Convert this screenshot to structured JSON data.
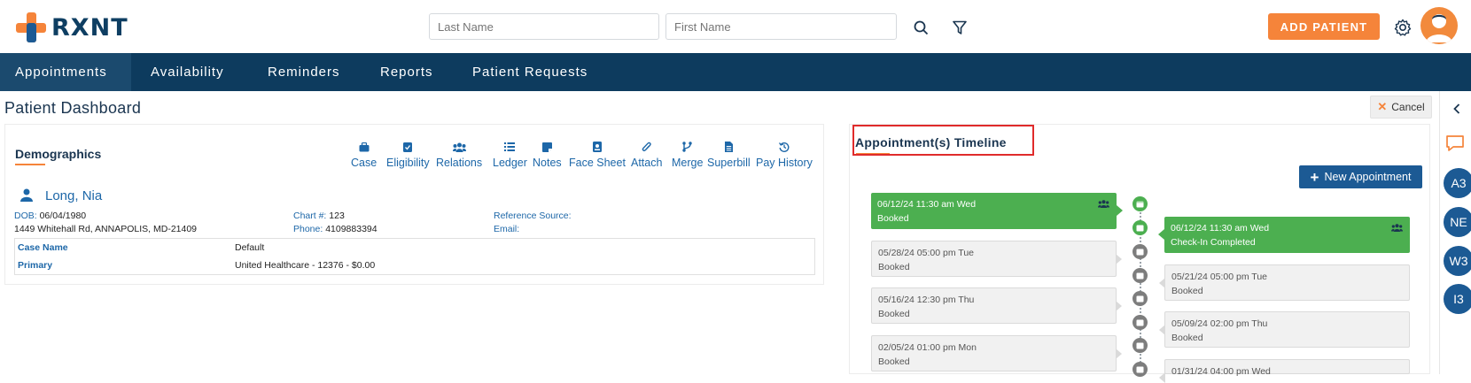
{
  "brand": {
    "name": "RXNT",
    "plus_color": "#f5843a",
    "plus_color2": "#1c5a94"
  },
  "search": {
    "last_name_placeholder": "Last Name",
    "first_name_placeholder": "First Name"
  },
  "header": {
    "add_patient_label": "ADD PATIENT"
  },
  "nav": {
    "items": [
      {
        "label": "Appointments"
      },
      {
        "label": "Availability"
      },
      {
        "label": "Reminders"
      },
      {
        "label": "Reports"
      },
      {
        "label": "Patient Requests"
      }
    ]
  },
  "page": {
    "title": "Patient Dashboard",
    "cancel_label": "Cancel"
  },
  "demographics": {
    "title": "Demographics",
    "tools": [
      {
        "label": "Case",
        "icon": "briefcase-icon"
      },
      {
        "label": "Eligibility",
        "icon": "clipboard-check-icon"
      },
      {
        "label": "Relations",
        "icon": "users-icon"
      },
      {
        "label": "Ledger",
        "icon": "list-icon"
      },
      {
        "label": "Notes",
        "icon": "note-icon"
      },
      {
        "label": "Face Sheet",
        "icon": "id-card-icon"
      },
      {
        "label": "Attach",
        "icon": "paperclip-icon"
      },
      {
        "label": "Merge",
        "icon": "merge-icon"
      },
      {
        "label": "Superbill",
        "icon": "document-icon"
      },
      {
        "label": "Pay History",
        "icon": "history-icon"
      }
    ],
    "patient_name": "Long, Nia",
    "dob_label": "DOB:",
    "dob": "06/04/1980",
    "address": "1449 Whitehall Rd, ANNAPOLIS, MD-21409",
    "chart_label": "Chart #:",
    "chart": "123",
    "phone_label": "Phone:",
    "phone": "4109883394",
    "ref_label": "Reference Source:",
    "email_label": "Email:",
    "case_rows": [
      {
        "key": "Case Name",
        "value": "Default"
      },
      {
        "key": "Primary",
        "value": "United Healthcare - 12376 - $0.00"
      }
    ]
  },
  "timeline": {
    "title": "Appointment(s) Timeline",
    "new_button": "New Appointment",
    "left": [
      {
        "date": "06/12/24 11:30 am Wed",
        "status": "Booked",
        "style": "green"
      },
      {
        "date": "05/28/24 05:00 pm Tue",
        "status": "Booked",
        "style": "gray"
      },
      {
        "date": "05/16/24 12:30 pm Thu",
        "status": "Booked",
        "style": "gray"
      },
      {
        "date": "02/05/24 01:00 pm Mon",
        "status": "Booked",
        "style": "gray"
      }
    ],
    "right": [
      {
        "date": "06/12/24 11:30 am Wed",
        "status": "Check-In Completed",
        "style": "green"
      },
      {
        "date": "05/21/24 05:00 pm Tue",
        "status": "Booked",
        "style": "gray"
      },
      {
        "date": "05/09/24 02:00 pm Thu",
        "status": "Booked",
        "style": "gray"
      },
      {
        "date": "01/31/24 04:00 pm Wed",
        "status": "",
        "style": "gray"
      }
    ]
  },
  "rail": {
    "avatars": [
      "A3",
      "NE",
      "W3",
      "I3"
    ]
  },
  "colors": {
    "navy": "#0d3b5e",
    "orange": "#f5843a",
    "green": "#4caf50",
    "blue": "#1d67a8"
  }
}
